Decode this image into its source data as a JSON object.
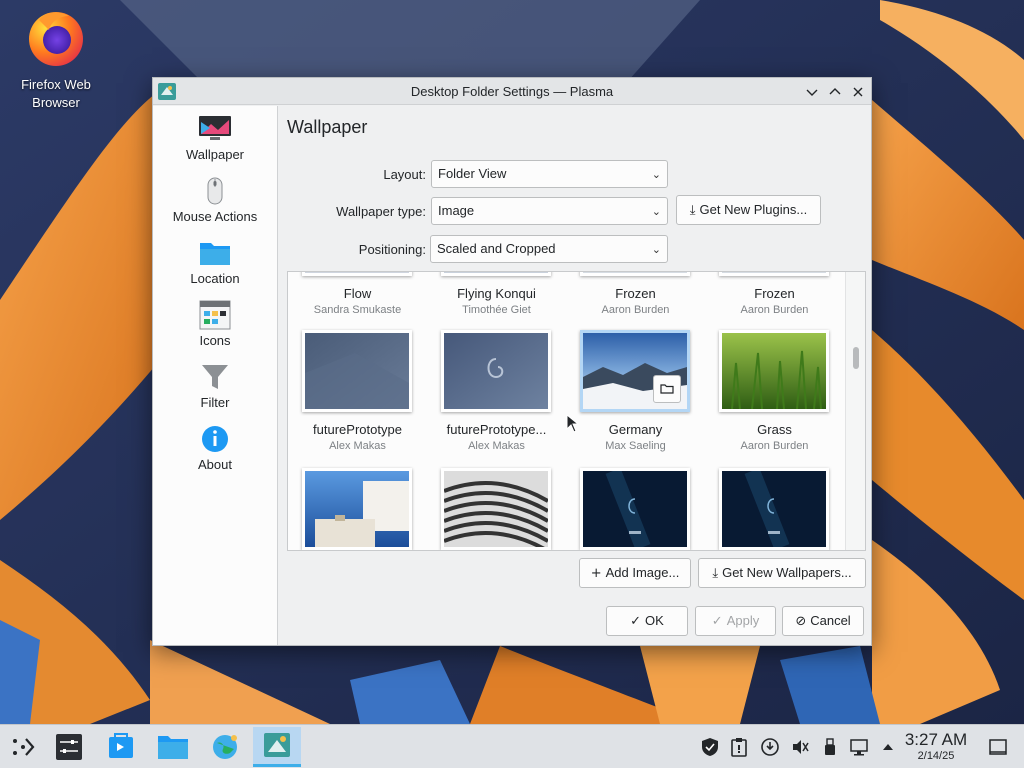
{
  "desktop": {
    "icons": [
      {
        "label": "Firefox Web Browser"
      }
    ]
  },
  "dialog": {
    "title": "Desktop Folder Settings — Plasma",
    "sidebar": [
      {
        "label": "Wallpaper",
        "icon": "monitor-icon"
      },
      {
        "label": "Mouse Actions",
        "icon": "mouse-icon"
      },
      {
        "label": "Location",
        "icon": "folder-icon"
      },
      {
        "label": "Icons",
        "icon": "icons-icon"
      },
      {
        "label": "Filter",
        "icon": "filter-icon"
      },
      {
        "label": "About",
        "icon": "info-icon"
      }
    ],
    "page_title": "Wallpaper",
    "form": {
      "layout_label": "Layout:",
      "layout_value": "Folder View",
      "wallpaper_type_label": "Wallpaper type:",
      "wallpaper_type_value": "Image",
      "get_plugins": "Get New Plugins...",
      "positioning_label": "Positioning:",
      "positioning_value": "Scaled and Cropped"
    },
    "wallpapers": [
      {
        "name": "Flow",
        "author": "Sandra Smukaste"
      },
      {
        "name": "Flying Konqui",
        "author": "Timothée Giet"
      },
      {
        "name": "Frozen",
        "author": "Aaron Burden"
      },
      {
        "name": "Frozen",
        "author": "Aaron Burden"
      },
      {
        "name": "futurePrototype",
        "author": "Alex Makas"
      },
      {
        "name": "futurePrototype...",
        "author": "Alex Makas"
      },
      {
        "name": "Germany",
        "author": "Max Saeling"
      },
      {
        "name": "Grass",
        "author": "Aaron Burden"
      }
    ],
    "buttons": {
      "add_image": "Add Image...",
      "get_wallpapers": "Get New Wallpapers...",
      "ok": "OK",
      "apply": "Apply",
      "cancel": "Cancel"
    }
  },
  "taskbar": {
    "time": "3:27 AM",
    "date": "2/14/25"
  }
}
